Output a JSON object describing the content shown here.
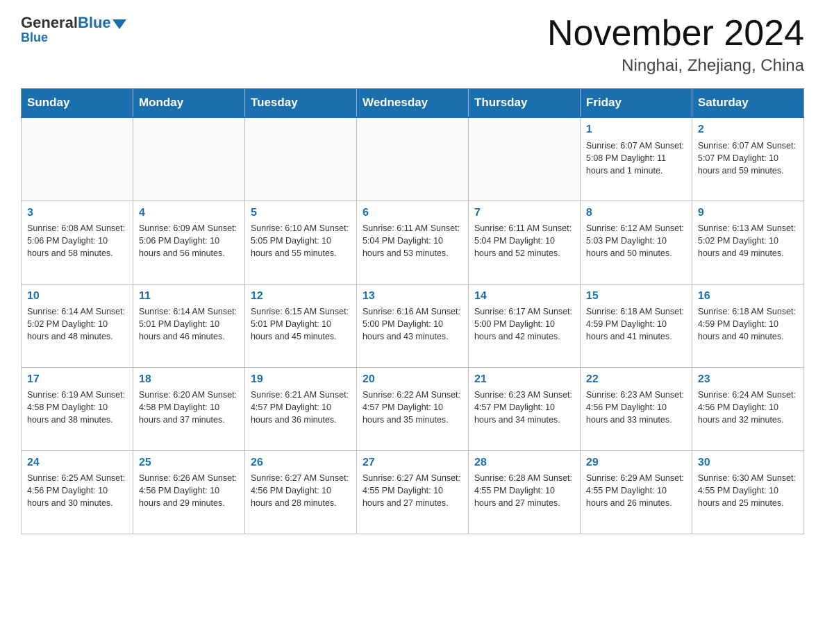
{
  "header": {
    "logo": {
      "general": "General",
      "blue": "Blue"
    },
    "month_title": "November 2024",
    "location": "Ninghai, Zhejiang, China"
  },
  "weekdays": [
    "Sunday",
    "Monday",
    "Tuesday",
    "Wednesday",
    "Thursday",
    "Friday",
    "Saturday"
  ],
  "weeks": [
    [
      {
        "day": "",
        "info": ""
      },
      {
        "day": "",
        "info": ""
      },
      {
        "day": "",
        "info": ""
      },
      {
        "day": "",
        "info": ""
      },
      {
        "day": "",
        "info": ""
      },
      {
        "day": "1",
        "info": "Sunrise: 6:07 AM\nSunset: 5:08 PM\nDaylight: 11 hours and 1 minute."
      },
      {
        "day": "2",
        "info": "Sunrise: 6:07 AM\nSunset: 5:07 PM\nDaylight: 10 hours and 59 minutes."
      }
    ],
    [
      {
        "day": "3",
        "info": "Sunrise: 6:08 AM\nSunset: 5:06 PM\nDaylight: 10 hours and 58 minutes."
      },
      {
        "day": "4",
        "info": "Sunrise: 6:09 AM\nSunset: 5:06 PM\nDaylight: 10 hours and 56 minutes."
      },
      {
        "day": "5",
        "info": "Sunrise: 6:10 AM\nSunset: 5:05 PM\nDaylight: 10 hours and 55 minutes."
      },
      {
        "day": "6",
        "info": "Sunrise: 6:11 AM\nSunset: 5:04 PM\nDaylight: 10 hours and 53 minutes."
      },
      {
        "day": "7",
        "info": "Sunrise: 6:11 AM\nSunset: 5:04 PM\nDaylight: 10 hours and 52 minutes."
      },
      {
        "day": "8",
        "info": "Sunrise: 6:12 AM\nSunset: 5:03 PM\nDaylight: 10 hours and 50 minutes."
      },
      {
        "day": "9",
        "info": "Sunrise: 6:13 AM\nSunset: 5:02 PM\nDaylight: 10 hours and 49 minutes."
      }
    ],
    [
      {
        "day": "10",
        "info": "Sunrise: 6:14 AM\nSunset: 5:02 PM\nDaylight: 10 hours and 48 minutes."
      },
      {
        "day": "11",
        "info": "Sunrise: 6:14 AM\nSunset: 5:01 PM\nDaylight: 10 hours and 46 minutes."
      },
      {
        "day": "12",
        "info": "Sunrise: 6:15 AM\nSunset: 5:01 PM\nDaylight: 10 hours and 45 minutes."
      },
      {
        "day": "13",
        "info": "Sunrise: 6:16 AM\nSunset: 5:00 PM\nDaylight: 10 hours and 43 minutes."
      },
      {
        "day": "14",
        "info": "Sunrise: 6:17 AM\nSunset: 5:00 PM\nDaylight: 10 hours and 42 minutes."
      },
      {
        "day": "15",
        "info": "Sunrise: 6:18 AM\nSunset: 4:59 PM\nDaylight: 10 hours and 41 minutes."
      },
      {
        "day": "16",
        "info": "Sunrise: 6:18 AM\nSunset: 4:59 PM\nDaylight: 10 hours and 40 minutes."
      }
    ],
    [
      {
        "day": "17",
        "info": "Sunrise: 6:19 AM\nSunset: 4:58 PM\nDaylight: 10 hours and 38 minutes."
      },
      {
        "day": "18",
        "info": "Sunrise: 6:20 AM\nSunset: 4:58 PM\nDaylight: 10 hours and 37 minutes."
      },
      {
        "day": "19",
        "info": "Sunrise: 6:21 AM\nSunset: 4:57 PM\nDaylight: 10 hours and 36 minutes."
      },
      {
        "day": "20",
        "info": "Sunrise: 6:22 AM\nSunset: 4:57 PM\nDaylight: 10 hours and 35 minutes."
      },
      {
        "day": "21",
        "info": "Sunrise: 6:23 AM\nSunset: 4:57 PM\nDaylight: 10 hours and 34 minutes."
      },
      {
        "day": "22",
        "info": "Sunrise: 6:23 AM\nSunset: 4:56 PM\nDaylight: 10 hours and 33 minutes."
      },
      {
        "day": "23",
        "info": "Sunrise: 6:24 AM\nSunset: 4:56 PM\nDaylight: 10 hours and 32 minutes."
      }
    ],
    [
      {
        "day": "24",
        "info": "Sunrise: 6:25 AM\nSunset: 4:56 PM\nDaylight: 10 hours and 30 minutes."
      },
      {
        "day": "25",
        "info": "Sunrise: 6:26 AM\nSunset: 4:56 PM\nDaylight: 10 hours and 29 minutes."
      },
      {
        "day": "26",
        "info": "Sunrise: 6:27 AM\nSunset: 4:56 PM\nDaylight: 10 hours and 28 minutes."
      },
      {
        "day": "27",
        "info": "Sunrise: 6:27 AM\nSunset: 4:55 PM\nDaylight: 10 hours and 27 minutes."
      },
      {
        "day": "28",
        "info": "Sunrise: 6:28 AM\nSunset: 4:55 PM\nDaylight: 10 hours and 27 minutes."
      },
      {
        "day": "29",
        "info": "Sunrise: 6:29 AM\nSunset: 4:55 PM\nDaylight: 10 hours and 26 minutes."
      },
      {
        "day": "30",
        "info": "Sunrise: 6:30 AM\nSunset: 4:55 PM\nDaylight: 10 hours and 25 minutes."
      }
    ]
  ]
}
